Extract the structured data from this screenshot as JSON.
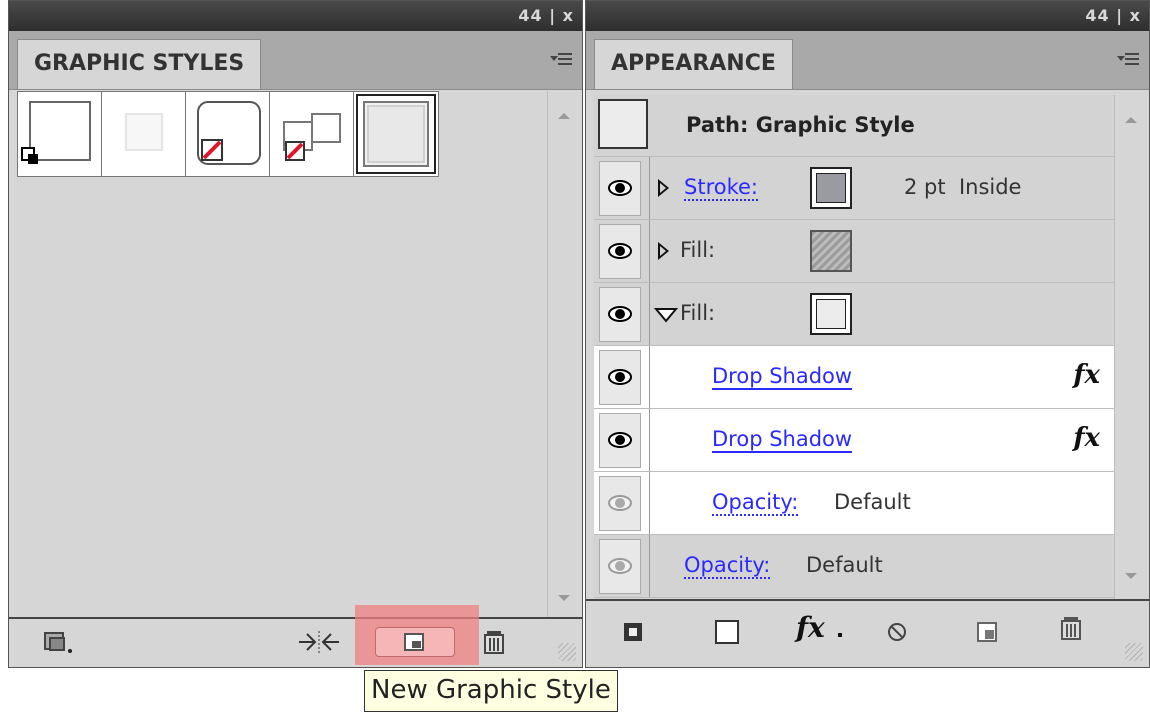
{
  "graphic_styles": {
    "title": "GRAPHIC STYLES",
    "panel_controls": "44 | x"
  },
  "appearance": {
    "title": "APPEARANCE",
    "panel_controls": "44 | x",
    "header": "Path: Graphic Style",
    "rows": [
      {
        "label": "Stroke:",
        "value": "2 pt  Inside"
      },
      {
        "label": "Fill:"
      },
      {
        "label": "Fill:"
      },
      {
        "label": "Drop Shadow",
        "fx": "fx"
      },
      {
        "label": "Drop Shadow",
        "fx": "fx"
      },
      {
        "label": "Opacity:",
        "value": "Default"
      },
      {
        "label": "Opacity:",
        "value": "Default"
      }
    ],
    "footer_fx": "fx"
  },
  "tooltip": "New Graphic Style",
  "colors": {
    "panel_bg": "#d6d6d6",
    "link": "#2a2aff",
    "highlight": "#f08080",
    "tooltip_bg": "#ffffe1"
  }
}
